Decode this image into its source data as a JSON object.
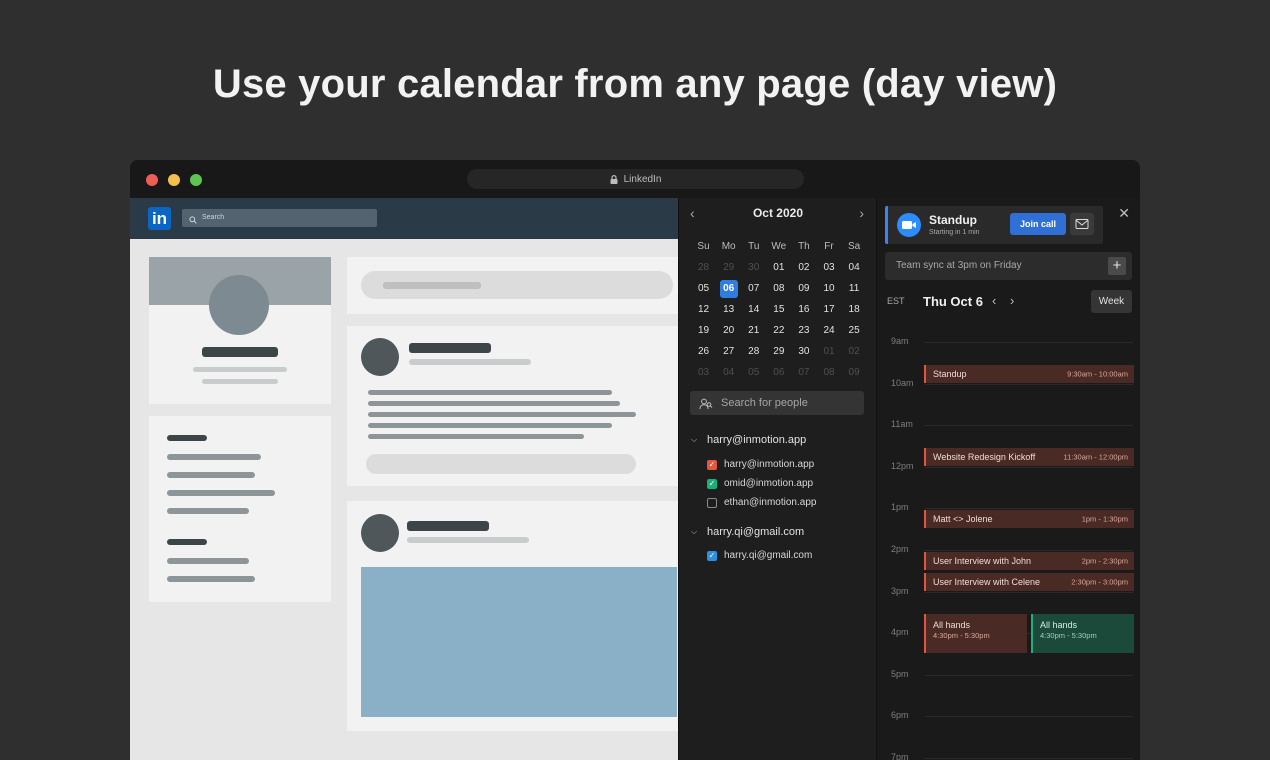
{
  "headline": "Use your calendar from any page (day view)",
  "browser": {
    "url_title": "LinkedIn"
  },
  "linkedin": {
    "logo": "in",
    "search_placeholder": "Search"
  },
  "mini_calendar": {
    "month_label": "Oct 2020",
    "weekdays": [
      "Su",
      "Mo",
      "Tu",
      "We",
      "Th",
      "Fr",
      "Sa"
    ],
    "weeks": [
      [
        {
          "d": "28",
          "dim": true
        },
        {
          "d": "29",
          "dim": true
        },
        {
          "d": "30",
          "dim": true
        },
        {
          "d": "01"
        },
        {
          "d": "02"
        },
        {
          "d": "03"
        },
        {
          "d": "04"
        }
      ],
      [
        {
          "d": "05"
        },
        {
          "d": "06",
          "sel": true
        },
        {
          "d": "07"
        },
        {
          "d": "08"
        },
        {
          "d": "09"
        },
        {
          "d": "10"
        },
        {
          "d": "11"
        }
      ],
      [
        {
          "d": "12"
        },
        {
          "d": "13"
        },
        {
          "d": "14"
        },
        {
          "d": "15"
        },
        {
          "d": "16"
        },
        {
          "d": "17"
        },
        {
          "d": "18"
        }
      ],
      [
        {
          "d": "19"
        },
        {
          "d": "20"
        },
        {
          "d": "21"
        },
        {
          "d": "22"
        },
        {
          "d": "23"
        },
        {
          "d": "24"
        },
        {
          "d": "25"
        }
      ],
      [
        {
          "d": "26"
        },
        {
          "d": "27"
        },
        {
          "d": "28"
        },
        {
          "d": "29"
        },
        {
          "d": "30"
        },
        {
          "d": "01",
          "dim": true
        },
        {
          "d": "02",
          "dim": true
        }
      ],
      [
        {
          "d": "03",
          "dim": true
        },
        {
          "d": "04",
          "dim": true
        },
        {
          "d": "05",
          "dim": true
        },
        {
          "d": "06",
          "dim": true
        },
        {
          "d": "07",
          "dim": true
        },
        {
          "d": "08",
          "dim": true
        },
        {
          "d": "09",
          "dim": true
        }
      ]
    ],
    "selected_color": "#2f7de1"
  },
  "people_search": {
    "placeholder": "Search for people"
  },
  "accounts": [
    {
      "name": "harry@inmotion.app",
      "calendars": [
        {
          "name": "harry@inmotion.app",
          "checked": true,
          "color": "#e0573d"
        },
        {
          "name": "omid@inmotion.app",
          "checked": true,
          "color": "#19b07a"
        },
        {
          "name": "ethan@inmotion.app",
          "checked": false,
          "color": ""
        }
      ]
    },
    {
      "name": "harry.qi@gmail.com",
      "calendars": [
        {
          "name": "harry.qi@gmail.com",
          "checked": true,
          "color": "#2f8fe0"
        }
      ]
    }
  ],
  "upcoming": {
    "title": "Standup",
    "subtitle": "Starting in 1 min",
    "join_label": "Join call"
  },
  "quick_add": {
    "placeholder": "Team sync at 3pm on Friday",
    "add_label": "+"
  },
  "day_view": {
    "timezone": "EST",
    "date_label": "Thu Oct 6",
    "view_button": "Week",
    "hours": [
      "9am",
      "10am",
      "11am",
      "12pm",
      "1pm",
      "2pm",
      "3pm",
      "4pm",
      "5pm",
      "6pm",
      "7pm"
    ],
    "events": [
      {
        "title": "Standup",
        "time": "9:30am - 10:00am",
        "start": 9.5,
        "end": 10.0,
        "color": "red",
        "col": 0,
        "cols": 1
      },
      {
        "title": "Website Redesign Kickoff",
        "time": "11:30am - 12:00pm",
        "start": 11.5,
        "end": 12.0,
        "color": "red",
        "col": 0,
        "cols": 1
      },
      {
        "title": "Matt <> Jolene",
        "time": "1pm - 1:30pm",
        "start": 13.0,
        "end": 13.5,
        "color": "red",
        "col": 0,
        "cols": 1
      },
      {
        "title": "User Interview with John",
        "time": "2pm - 2:30pm",
        "start": 14.0,
        "end": 14.5,
        "color": "red",
        "col": 0,
        "cols": 1
      },
      {
        "title": "User Interview with Celene",
        "time": "2:30pm - 3:00pm",
        "start": 14.5,
        "end": 15.0,
        "color": "red",
        "col": 0,
        "cols": 1
      },
      {
        "title": "All hands",
        "time": "4:30pm - 5:30pm",
        "start": 15.5,
        "end": 16.5,
        "color": "red",
        "col": 0,
        "cols": 2
      },
      {
        "title": "All hands",
        "time": "4:30pm - 5:30pm",
        "start": 15.5,
        "end": 16.5,
        "color": "green",
        "col": 1,
        "cols": 2
      }
    ]
  }
}
